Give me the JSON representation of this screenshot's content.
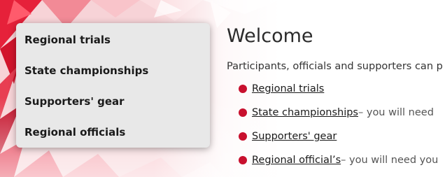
{
  "colors": {
    "accent": "#c8102e",
    "menu_bg": "#e8e8e8"
  },
  "menu": {
    "items": [
      {
        "label": "Regional trials"
      },
      {
        "label": "State championships"
      },
      {
        "label": "Supporters' gear"
      },
      {
        "label": "Regional officials"
      }
    ]
  },
  "main": {
    "title": "Welcome",
    "intro": "Participants, officials and supporters can p",
    "links": [
      {
        "label": "Regional trials",
        "suffix": ""
      },
      {
        "label": "State championships",
        "suffix": " – you will need"
      },
      {
        "label": "Supporters' gear",
        "suffix": ""
      },
      {
        "label": "Regional official’s",
        "suffix": " – you will need you"
      }
    ]
  }
}
